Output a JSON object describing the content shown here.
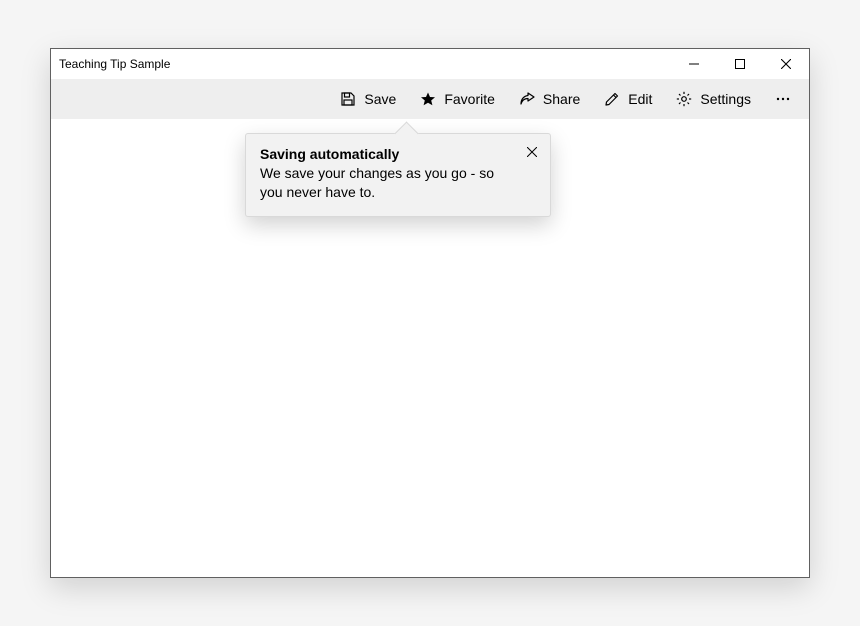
{
  "window": {
    "title": "Teaching Tip Sample"
  },
  "commandbar": {
    "save_label": "Save",
    "favorite_label": "Favorite",
    "share_label": "Share",
    "edit_label": "Edit",
    "settings_label": "Settings"
  },
  "teaching_tip": {
    "title": "Saving automatically",
    "subtitle": "We save your changes as you go - so you never have to."
  }
}
